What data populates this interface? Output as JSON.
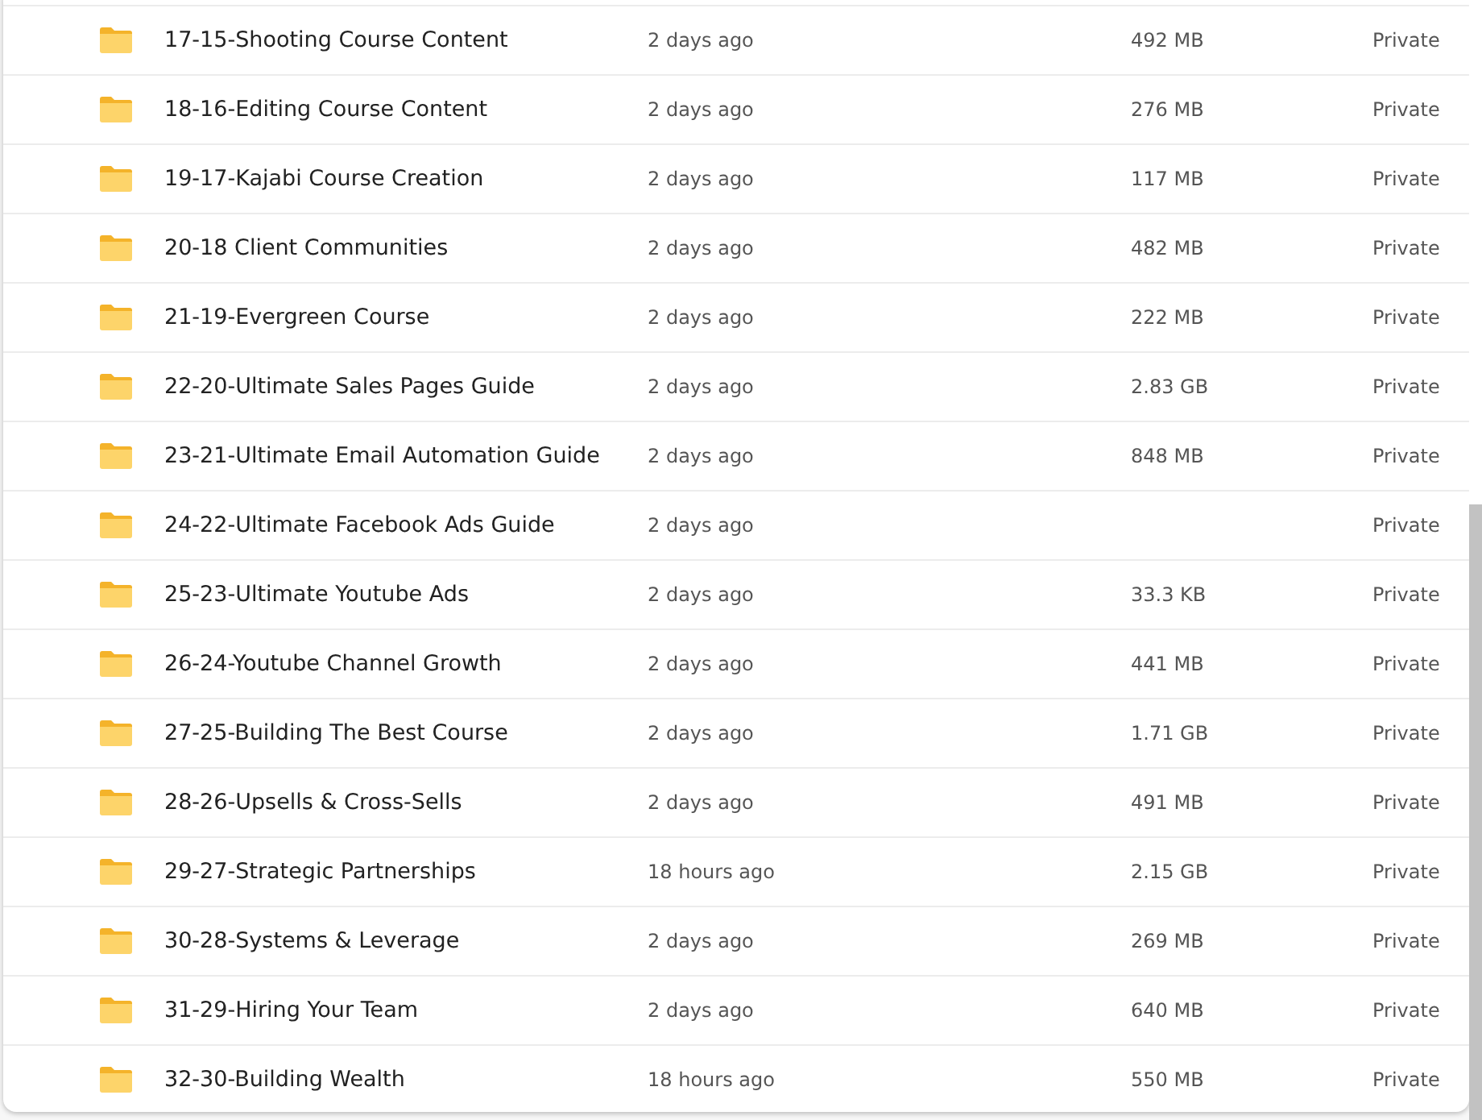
{
  "rows": [
    {
      "name": "17-15-Shooting Course Content",
      "modified": "2 days ago",
      "size": "492 MB",
      "sharing": "Private"
    },
    {
      "name": "18-16-Editing Course Content",
      "modified": "2 days ago",
      "size": "276 MB",
      "sharing": "Private"
    },
    {
      "name": "19-17-Kajabi Course Creation",
      "modified": "2 days ago",
      "size": "117 MB",
      "sharing": "Private"
    },
    {
      "name": "20-18 Client Communities",
      "modified": "2 days ago",
      "size": "482 MB",
      "sharing": "Private"
    },
    {
      "name": "21-19-Evergreen Course",
      "modified": "2 days ago",
      "size": "222 MB",
      "sharing": "Private"
    },
    {
      "name": "22-20-Ultimate Sales Pages Guide",
      "modified": "2 days ago",
      "size": "2.83 GB",
      "sharing": "Private"
    },
    {
      "name": "23-21-Ultimate Email Automation Guide",
      "modified": "2 days ago",
      "size": "848 MB",
      "sharing": "Private"
    },
    {
      "name": "24-22-Ultimate Facebook Ads Guide",
      "modified": "2 days ago",
      "sharing": "Private"
    },
    {
      "name": "25-23-Ultimate Youtube Ads",
      "modified": "2 days ago",
      "size": "33.3 KB",
      "sharing": "Private"
    },
    {
      "name": "26-24-Youtube Channel Growth",
      "modified": "2 days ago",
      "size": "441 MB",
      "sharing": "Private"
    },
    {
      "name": "27-25-Building The Best Course",
      "modified": "2 days ago",
      "size": "1.71 GB",
      "sharing": "Private"
    },
    {
      "name": "28-26-Upsells & Cross-Sells",
      "modified": "2 days ago",
      "size": "491 MB",
      "sharing": "Private"
    },
    {
      "name": "29-27-Strategic Partnerships",
      "modified": "18 hours ago",
      "size": "2.15 GB",
      "sharing": "Private"
    },
    {
      "name": "30-28-Systems & Leverage",
      "modified": "2 days ago",
      "size": "269 MB",
      "sharing": "Private"
    },
    {
      "name": "31-29-Hiring Your Team",
      "modified": "2 days ago",
      "size": "640 MB",
      "sharing": "Private"
    },
    {
      "name": "32-30-Building Wealth",
      "modified": "18 hours ago",
      "size": "550 MB",
      "sharing": "Private"
    }
  ]
}
